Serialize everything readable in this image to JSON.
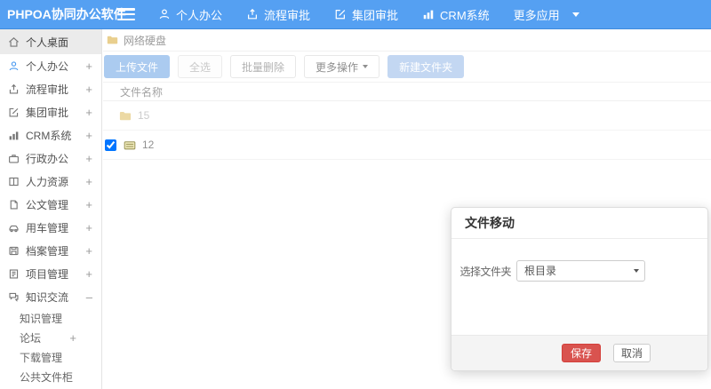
{
  "topbar": {
    "brand": "PHPOA协同办公软件",
    "nav": [
      {
        "label": "个人办公",
        "icon": "user-icon"
      },
      {
        "label": "流程审批",
        "icon": "upload-icon"
      },
      {
        "label": "集团审批",
        "icon": "edit-icon"
      },
      {
        "label": "CRM系统",
        "icon": "bar-chart-icon"
      },
      {
        "label": "更多应用",
        "icon": "caret-down-icon"
      }
    ]
  },
  "sidebar": {
    "active_item": {
      "label": "个人桌面"
    },
    "items": [
      {
        "label": "个人办公",
        "expand": "+"
      },
      {
        "label": "流程审批",
        "expand": "+"
      },
      {
        "label": "集团审批",
        "expand": "+"
      },
      {
        "label": "CRM系统",
        "expand": "+"
      },
      {
        "label": "行政办公",
        "expand": "+"
      },
      {
        "label": "人力资源",
        "expand": "+"
      },
      {
        "label": "公文管理",
        "expand": "+"
      },
      {
        "label": "用车管理",
        "expand": "+"
      },
      {
        "label": "档案管理",
        "expand": "+"
      },
      {
        "label": "项目管理",
        "expand": "+"
      },
      {
        "label": "知识交流",
        "expand": "–"
      }
    ],
    "subitems": [
      {
        "label": "知识管理",
        "expand": ""
      },
      {
        "label": "论坛",
        "expand": "+"
      },
      {
        "label": "下载管理",
        "expand": ""
      },
      {
        "label": "公共文件柜",
        "expand": ""
      }
    ]
  },
  "breadcrumb": {
    "label": "网络硬盘"
  },
  "toolbar": {
    "upload": "上传文件",
    "select_all": "全选",
    "batch_delete": "批量删除",
    "more_ops": "更多操作",
    "new_folder": "新建文件夹"
  },
  "file_table": {
    "header": "文件名称",
    "rows": [
      {
        "name": "15",
        "type": "folder",
        "checked": false
      },
      {
        "name": "12",
        "type": "disk",
        "checked": true
      }
    ]
  },
  "modal": {
    "title": "文件移动",
    "field_label": "选择文件夹",
    "selected_option": "根目录",
    "save": "保存",
    "cancel": "取消"
  },
  "colors": {
    "topbar_blue": "#55a0f2",
    "primary_light": "#abcbf0",
    "danger_red": "#d9534f",
    "folder_yellow": "#e9cf8e",
    "active_gray": "#ebebeb"
  }
}
